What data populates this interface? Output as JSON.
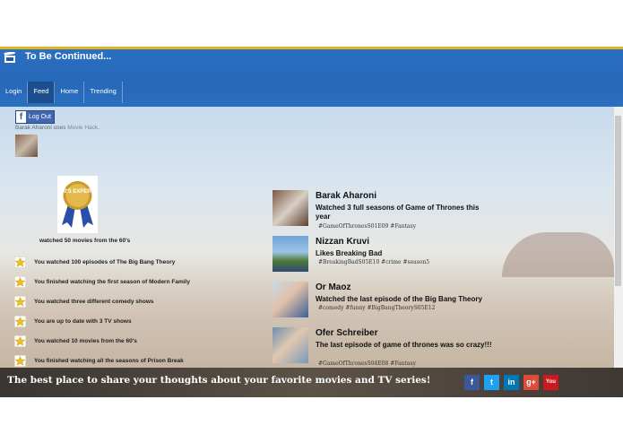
{
  "app": {
    "title": "To Be Continued...",
    "logo_icon": "clapperboard-icon"
  },
  "nav": [
    {
      "label": "Login"
    },
    {
      "label": "Feed",
      "active": true
    },
    {
      "label": "Home"
    },
    {
      "label": "Trending"
    }
  ],
  "sidebar": {
    "logout_label": "Log Out",
    "uses_user": "Barak Aharoni",
    "uses_word": " uses ",
    "uses_app": "Movie Hack",
    "uses_end": ".",
    "badge_text": "60'S EXPERT",
    "badge_caption": "watched 50 movies from the 60's",
    "achievements": [
      {
        "text": "You watched 100 episodes of The Big Bang Theory"
      },
      {
        "text": "You finished watching the first season of Modern Family"
      },
      {
        "text": "You watched three different comedy shows"
      },
      {
        "text": "You are up to date with 3 TV shows"
      },
      {
        "text": "You watched 10 movies from the 60's"
      },
      {
        "text": "You finished watching all the seasons of Prison Break"
      }
    ]
  },
  "feed": [
    {
      "name": "Barak Aharoni",
      "text": "Watched 3 full seasons of Game of Thrones this year",
      "tags": "#GameOfThronesS01E09 #Fantasy"
    },
    {
      "name": "Nizzan Kruvi",
      "text": "Likes Breaking Bad",
      "tags": "#BreakingBadS05E10 #crime #season5"
    },
    {
      "name": "Or Maoz",
      "text": "Watched the last episode of the Big Bang Theory",
      "tags": "#comedy #funny #BigBangTheoryS05E12"
    },
    {
      "name": "Ofer Schreiber",
      "text": "The last episode of game of thrones was so crazy!!!",
      "tags": "#GameOfThronesS04E08 #Fantasy"
    }
  ],
  "footer": {
    "tagline": "The best place to share your thoughts about your favorite movies and TV series!",
    "social": [
      {
        "icon": "facebook-icon",
        "glyph": "f",
        "color": "#3b5998"
      },
      {
        "icon": "twitter-icon",
        "glyph": "t",
        "color": "#1da1f2"
      },
      {
        "icon": "linkedin-icon",
        "glyph": "in",
        "color": "#0077b5"
      },
      {
        "icon": "googleplus-icon",
        "glyph": "g+",
        "color": "#dd4b39"
      },
      {
        "icon": "youtube-icon",
        "glyph": "You",
        "color": "#cc181e"
      }
    ]
  },
  "colors": {
    "header_blue": "#2a6fc2",
    "accent_stripe": "#e0b420",
    "nav_active": "#1c4f8d"
  }
}
